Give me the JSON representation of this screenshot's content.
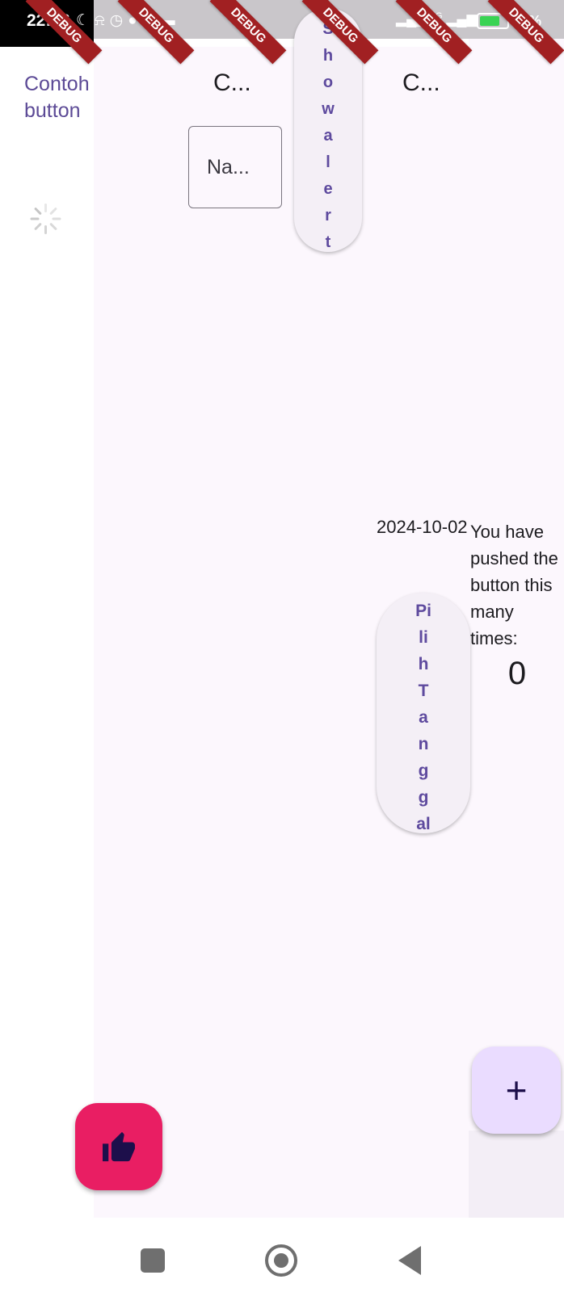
{
  "status_bar": {
    "time": "22:36",
    "battery": "76%",
    "battery_level": 0.76,
    "network": "4G",
    "icons_left": [
      "moon-icon",
      "bell-off-icon",
      "alarm-icon",
      "pinterest-icon",
      "upload-icon",
      "video-icon"
    ],
    "icons_right": [
      "signal-icon",
      "signal-icon",
      "battery-charging-icon"
    ]
  },
  "debug_banner": "DEBUG",
  "left_button": {
    "label": "Contoh button"
  },
  "top_row": {
    "text_1": "C...",
    "text_2": "C...",
    "name_field": "Na..."
  },
  "show_alert_button": {
    "label": "Showalert",
    "letters": [
      "S",
      "h",
      "o",
      "w",
      "a",
      "l",
      "e",
      "r",
      "t"
    ]
  },
  "date": {
    "value": "2024-10-02",
    "pick_button_letters": [
      "Pi",
      "li",
      "h",
      "T",
      "a",
      "n",
      "g",
      "g",
      "al"
    ]
  },
  "counter": {
    "label": "You have pushed the button this many times:",
    "value": "0"
  },
  "fab": {
    "plus_label": "+",
    "like_icon": "thumb-up-icon"
  },
  "colors": {
    "background": "#fcf7fd",
    "primary_text": "#5c4a96",
    "like_fab": "#e91e63",
    "plus_fab": "#eadcff",
    "debug_banner": "#a12022"
  }
}
